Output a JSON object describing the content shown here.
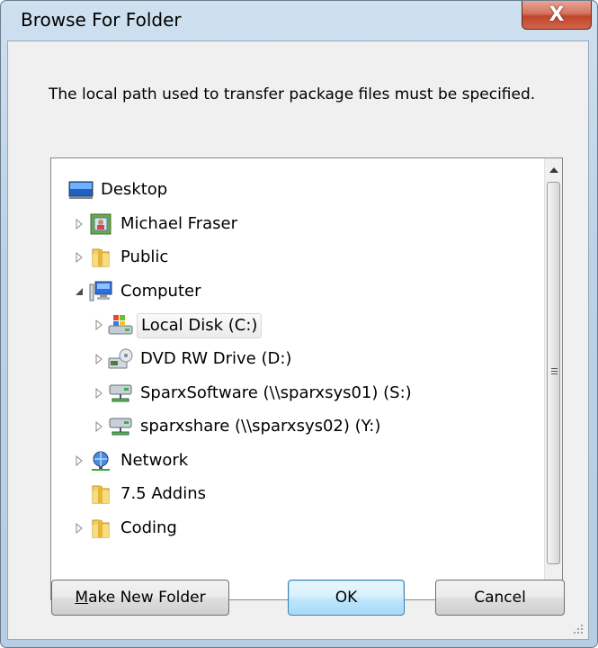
{
  "window": {
    "title": "Browse For Folder",
    "close_glyph": "X"
  },
  "message": "The local path used to transfer package files must be specified.",
  "tree": {
    "nodes": [
      {
        "label": "Desktop",
        "icon": "desktop-icon",
        "expander": "none",
        "level": 0
      },
      {
        "label": "Michael Fraser",
        "icon": "user-folder-icon",
        "expander": "collapsed",
        "level": 1
      },
      {
        "label": "Public",
        "icon": "folder-icon",
        "expander": "collapsed",
        "level": 1
      },
      {
        "label": "Computer",
        "icon": "computer-icon",
        "expander": "expanded",
        "level": 1
      },
      {
        "label": "Local Disk (C:)",
        "icon": "local-disk-icon",
        "expander": "collapsed",
        "level": 2,
        "selected": true
      },
      {
        "label": "DVD RW Drive (D:)",
        "icon": "dvd-drive-icon",
        "expander": "collapsed",
        "level": 2
      },
      {
        "label": "SparxSoftware (\\\\sparxsys01) (S:)",
        "icon": "network-drive-icon",
        "expander": "collapsed",
        "level": 2
      },
      {
        "label": "sparxshare (\\\\sparxsys02) (Y:)",
        "icon": "network-drive-icon",
        "expander": "collapsed",
        "level": 2
      },
      {
        "label": "Network",
        "icon": "network-icon",
        "expander": "collapsed",
        "level": 1
      },
      {
        "label": "7.5 Addins",
        "icon": "folder-icon",
        "expander": "none",
        "level": 1
      },
      {
        "label": "Coding",
        "icon": "folder-icon",
        "expander": "collapsed",
        "level": 1
      }
    ]
  },
  "buttons": {
    "make_new_folder_prefix": "M",
    "make_new_folder_rest": "ake New Folder",
    "ok": "OK",
    "cancel": "Cancel"
  },
  "colors": {
    "window_frame": "#bcd2e8",
    "client_bg": "#f0f0f0",
    "close_button": "#c0462d",
    "default_button_border": "#3c7fb1"
  }
}
